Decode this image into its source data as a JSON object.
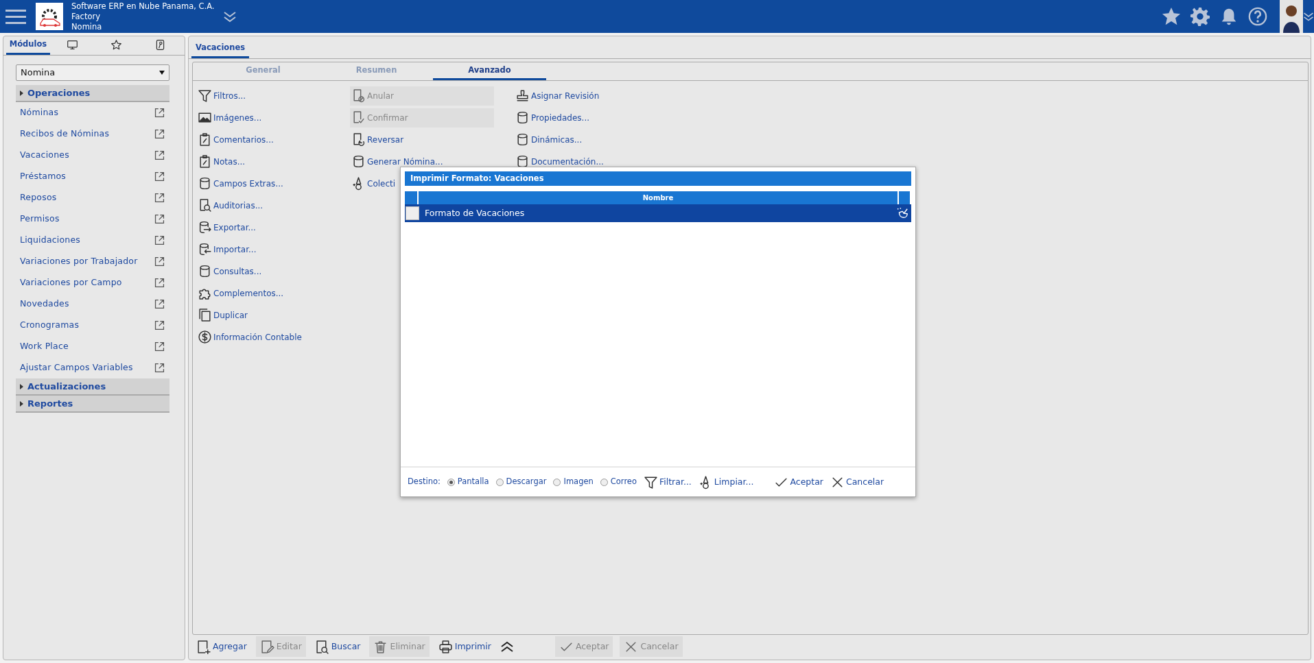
{
  "header": {
    "company": "Software ERP en Nube Panama, C.A.",
    "branch": "Factory",
    "module": "Nomina"
  },
  "sidebar": {
    "tabs": [
      {
        "kind": "text",
        "label": "Módulos",
        "selected": true
      },
      {
        "kind": "monitor",
        "selected": false
      },
      {
        "kind": "star",
        "selected": false
      },
      {
        "kind": "key",
        "selected": false
      }
    ],
    "module_select": {
      "value": "Nomina"
    },
    "sections": [
      {
        "label": "Operaciones",
        "items": [
          "Nóminas",
          "Recibos de Nóminas",
          "Vacaciones",
          "Préstamos",
          "Reposos",
          "Permisos",
          "Liquidaciones",
          "Variaciones por Trabajador",
          "Variaciones por Campo",
          "Novedades",
          "Cronogramas",
          "Work Place",
          "Ajustar Campos Variables"
        ]
      },
      {
        "label": "Actualizaciones"
      },
      {
        "label": "Reportes"
      }
    ]
  },
  "document_tabs": [
    {
      "label": "Vacaciones",
      "selected": true
    }
  ],
  "subtabs": [
    {
      "label": "General",
      "selected": false
    },
    {
      "label": "Resumen",
      "selected": false
    },
    {
      "label": "Avanzado",
      "selected": true
    }
  ],
  "action_columns": [
    {
      "items": [
        {
          "label": "Filtros...",
          "kind": "filter",
          "disabled": false
        },
        {
          "label": "Imágenes...",
          "kind": "image",
          "disabled": false
        },
        {
          "label": "Comentarios...",
          "kind": "clipboard",
          "disabled": false
        },
        {
          "label": "Notas...",
          "kind": "clipboard",
          "disabled": false
        },
        {
          "label": "Campos Extras...",
          "kind": "database",
          "disabled": false
        },
        {
          "label": "Auditorias...",
          "kind": "audit",
          "disabled": false
        },
        {
          "label": "Exportar...",
          "kind": "export",
          "disabled": false
        },
        {
          "label": "Importar...",
          "kind": "import",
          "disabled": false
        },
        {
          "label": "Consultas...",
          "kind": "database",
          "disabled": false
        },
        {
          "label": "Complementos...",
          "kind": "puzzle",
          "disabled": false
        },
        {
          "label": "Duplicar",
          "kind": "copy",
          "disabled": false
        },
        {
          "label": "Información Contable",
          "kind": "dollar",
          "disabled": false
        }
      ]
    },
    {
      "items": [
        {
          "label": "Anular",
          "kind": "void",
          "disabled": true
        },
        {
          "label": "Confirmar",
          "kind": "confirm",
          "disabled": true
        },
        {
          "label": "Reversar",
          "kind": "reverse",
          "disabled": false
        },
        {
          "label": "Generar Nómina...",
          "kind": "database",
          "disabled": false
        },
        {
          "label": "Colecti",
          "kind": "wizard",
          "disabled": false
        }
      ]
    },
    {
      "items": [
        {
          "label": "Asignar Revisión",
          "kind": "stamp",
          "disabled": false
        },
        {
          "label": "Propiedades...",
          "kind": "database",
          "disabled": false
        },
        {
          "label": "Dinámicas...",
          "kind": "database",
          "disabled": false
        },
        {
          "label": "Documentación...",
          "kind": "database",
          "disabled": false
        }
      ]
    }
  ],
  "dialog": {
    "title": "Imprimir Formato: Vacaciones",
    "columns": [
      "Nombre"
    ],
    "rows": [
      {
        "name": "Formato de Vacaciones",
        "selected": true,
        "checked": false
      }
    ],
    "destination_label": "Destino:",
    "destinations": [
      {
        "label": "Pantalla",
        "selected": true
      },
      {
        "label": "Descargar",
        "selected": false
      },
      {
        "label": "Imagen",
        "selected": false
      },
      {
        "label": "Correo",
        "selected": false
      }
    ],
    "buttons": [
      {
        "label": "Filtrar...",
        "kind": "filter"
      },
      {
        "label": "Limpiar...",
        "kind": "wizard"
      },
      {
        "label": "Aceptar",
        "kind": "check"
      },
      {
        "label": "Cancelar",
        "kind": "x"
      }
    ]
  },
  "toolbar": [
    {
      "kind": "add",
      "label": "Agregar",
      "disabled": false
    },
    {
      "kind": "edit",
      "label": "Editar",
      "disabled": true
    },
    {
      "kind": "search",
      "label": "Buscar",
      "disabled": false
    },
    {
      "kind": "trash",
      "label": "Eliminar",
      "disabled": true
    },
    {
      "kind": "printer",
      "label": "Imprimir",
      "disabled": false
    },
    {
      "kind": "expander"
    },
    {
      "kind": "check",
      "label": "Aceptar",
      "disabled": true
    },
    {
      "kind": "x",
      "label": "Cancelar",
      "disabled": true
    }
  ]
}
